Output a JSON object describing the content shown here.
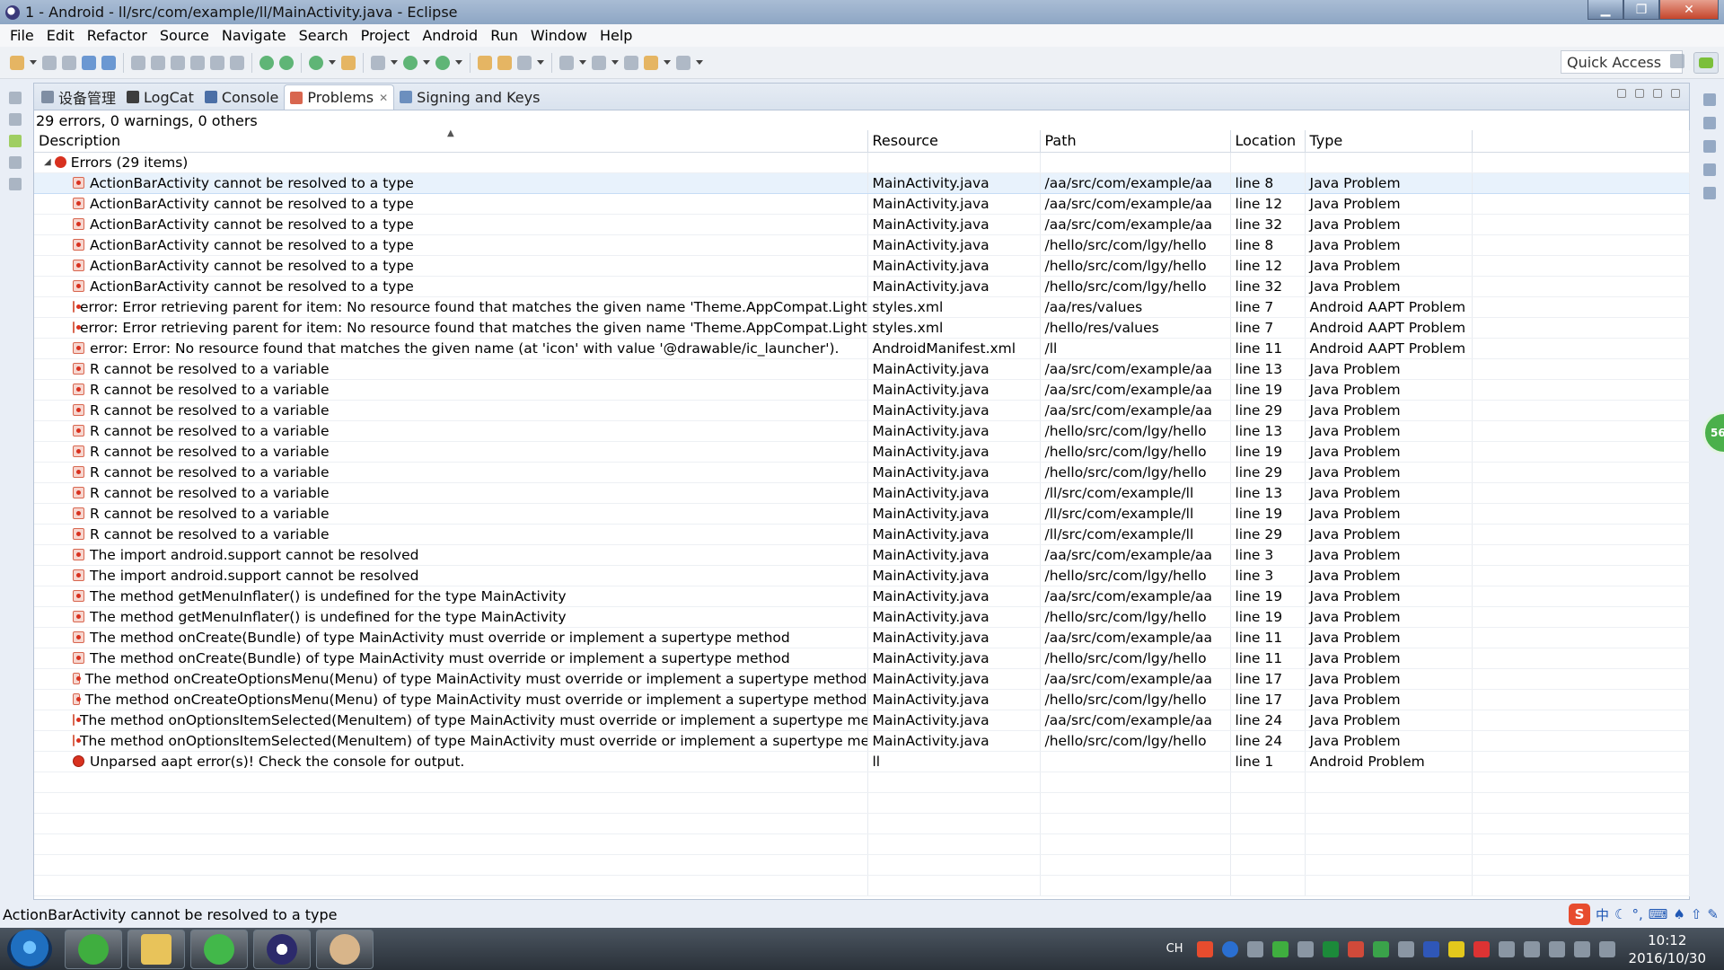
{
  "window": {
    "title": "1 - Android - ll/src/com/example/ll/MainActivity.java - Eclipse",
    "minimize_glyph": "▁",
    "maximize_glyph": "❐",
    "close_glyph": "✕"
  },
  "menu": [
    "File",
    "Edit",
    "Refactor",
    "Source",
    "Navigate",
    "Search",
    "Project",
    "Android",
    "Run",
    "Window",
    "Help"
  ],
  "toolbar": {
    "quick_access": "Quick Access"
  },
  "tabs": [
    {
      "label": "设备管理",
      "icon": "device-manager-icon"
    },
    {
      "label": "LogCat",
      "icon": "logcat-icon"
    },
    {
      "label": "Console",
      "icon": "console-icon"
    },
    {
      "label": "Problems",
      "icon": "problems-icon",
      "active": true
    },
    {
      "label": "Signing and Keys",
      "icon": "signing-icon"
    }
  ],
  "problems": {
    "summary": "29 errors, 0 warnings, 0 others",
    "columns": {
      "description": "Description",
      "resource": "Resource",
      "path": "Path",
      "location": "Location",
      "type": "Type"
    },
    "group_label": "Errors (29 items)",
    "rows": [
      {
        "description": "ActionBarActivity cannot be resolved to a type",
        "resource": "MainActivity.java",
        "path": "/aa/src/com/example/aa",
        "location": "line 8",
        "type": "Java Problem"
      },
      {
        "description": "ActionBarActivity cannot be resolved to a type",
        "resource": "MainActivity.java",
        "path": "/aa/src/com/example/aa",
        "location": "line 12",
        "type": "Java Problem"
      },
      {
        "description": "ActionBarActivity cannot be resolved to a type",
        "resource": "MainActivity.java",
        "path": "/aa/src/com/example/aa",
        "location": "line 32",
        "type": "Java Problem"
      },
      {
        "description": "ActionBarActivity cannot be resolved to a type",
        "resource": "MainActivity.java",
        "path": "/hello/src/com/lgy/hello",
        "location": "line 8",
        "type": "Java Problem"
      },
      {
        "description": "ActionBarActivity cannot be resolved to a type",
        "resource": "MainActivity.java",
        "path": "/hello/src/com/lgy/hello",
        "location": "line 12",
        "type": "Java Problem"
      },
      {
        "description": "ActionBarActivity cannot be resolved to a type",
        "resource": "MainActivity.java",
        "path": "/hello/src/com/lgy/hello",
        "location": "line 32",
        "type": "Java Problem"
      },
      {
        "description": "error: Error retrieving parent for item: No resource found that matches the given name 'Theme.AppCompat.Light'.",
        "resource": "styles.xml",
        "path": "/aa/res/values",
        "location": "line 7",
        "type": "Android AAPT Problem"
      },
      {
        "description": "error: Error retrieving parent for item: No resource found that matches the given name 'Theme.AppCompat.Light'.",
        "resource": "styles.xml",
        "path": "/hello/res/values",
        "location": "line 7",
        "type": "Android AAPT Problem"
      },
      {
        "description": "error: Error: No resource found that matches the given name (at 'icon' with value '@drawable/ic_launcher').",
        "resource": "AndroidManifest.xml",
        "path": "/ll",
        "location": "line 11",
        "type": "Android AAPT Problem"
      },
      {
        "description": "R cannot be resolved to a variable",
        "resource": "MainActivity.java",
        "path": "/aa/src/com/example/aa",
        "location": "line 13",
        "type": "Java Problem"
      },
      {
        "description": "R cannot be resolved to a variable",
        "resource": "MainActivity.java",
        "path": "/aa/src/com/example/aa",
        "location": "line 19",
        "type": "Java Problem"
      },
      {
        "description": "R cannot be resolved to a variable",
        "resource": "MainActivity.java",
        "path": "/aa/src/com/example/aa",
        "location": "line 29",
        "type": "Java Problem"
      },
      {
        "description": "R cannot be resolved to a variable",
        "resource": "MainActivity.java",
        "path": "/hello/src/com/lgy/hello",
        "location": "line 13",
        "type": "Java Problem"
      },
      {
        "description": "R cannot be resolved to a variable",
        "resource": "MainActivity.java",
        "path": "/hello/src/com/lgy/hello",
        "location": "line 19",
        "type": "Java Problem"
      },
      {
        "description": "R cannot be resolved to a variable",
        "resource": "MainActivity.java",
        "path": "/hello/src/com/lgy/hello",
        "location": "line 29",
        "type": "Java Problem"
      },
      {
        "description": "R cannot be resolved to a variable",
        "resource": "MainActivity.java",
        "path": "/ll/src/com/example/ll",
        "location": "line 13",
        "type": "Java Problem"
      },
      {
        "description": "R cannot be resolved to a variable",
        "resource": "MainActivity.java",
        "path": "/ll/src/com/example/ll",
        "location": "line 19",
        "type": "Java Problem"
      },
      {
        "description": "R cannot be resolved to a variable",
        "resource": "MainActivity.java",
        "path": "/ll/src/com/example/ll",
        "location": "line 29",
        "type": "Java Problem"
      },
      {
        "description": "The import android.support cannot be resolved",
        "resource": "MainActivity.java",
        "path": "/aa/src/com/example/aa",
        "location": "line 3",
        "type": "Java Problem"
      },
      {
        "description": "The import android.support cannot be resolved",
        "resource": "MainActivity.java",
        "path": "/hello/src/com/lgy/hello",
        "location": "line 3",
        "type": "Java Problem"
      },
      {
        "description": "The method getMenuInflater() is undefined for the type MainActivity",
        "resource": "MainActivity.java",
        "path": "/aa/src/com/example/aa",
        "location": "line 19",
        "type": "Java Problem"
      },
      {
        "description": "The method getMenuInflater() is undefined for the type MainActivity",
        "resource": "MainActivity.java",
        "path": "/hello/src/com/lgy/hello",
        "location": "line 19",
        "type": "Java Problem"
      },
      {
        "description": "The method onCreate(Bundle) of type MainActivity must override or implement a supertype method",
        "resource": "MainActivity.java",
        "path": "/aa/src/com/example/aa",
        "location": "line 11",
        "type": "Java Problem"
      },
      {
        "description": "The method onCreate(Bundle) of type MainActivity must override or implement a supertype method",
        "resource": "MainActivity.java",
        "path": "/hello/src/com/lgy/hello",
        "location": "line 11",
        "type": "Java Problem"
      },
      {
        "description": "The method onCreateOptionsMenu(Menu) of type MainActivity must override or implement a supertype method",
        "resource": "MainActivity.java",
        "path": "/aa/src/com/example/aa",
        "location": "line 17",
        "type": "Java Problem"
      },
      {
        "description": "The method onCreateOptionsMenu(Menu) of type MainActivity must override or implement a supertype method",
        "resource": "MainActivity.java",
        "path": "/hello/src/com/lgy/hello",
        "location": "line 17",
        "type": "Java Problem"
      },
      {
        "description": "The method onOptionsItemSelected(MenuItem) of type MainActivity must override or implement a supertype method",
        "resource": "MainActivity.java",
        "path": "/aa/src/com/example/aa",
        "location": "line 24",
        "type": "Java Problem"
      },
      {
        "description": "The method onOptionsItemSelected(MenuItem) of type MainActivity must override or implement a supertype method",
        "resource": "MainActivity.java",
        "path": "/hello/src/com/lgy/hello",
        "location": "line 24",
        "type": "Java Problem"
      },
      {
        "description": "Unparsed aapt error(s)! Check the console for output.",
        "resource": "ll",
        "path": "",
        "location": "line 1",
        "type": "Android Problem",
        "plain_icon": true
      }
    ]
  },
  "statusbar": {
    "message": "ActionBarActivity cannot be resolved to a type"
  },
  "ime": {
    "logo": "S",
    "mode": "中"
  },
  "float_ball": {
    "value": "56"
  },
  "taskbar": {
    "lang": "CH",
    "time": "10:12",
    "date": "2016/10/30"
  },
  "colors": {
    "error": "#d8311f",
    "selection": "#e8f2fc",
    "title_bar": "#8da6c4"
  }
}
